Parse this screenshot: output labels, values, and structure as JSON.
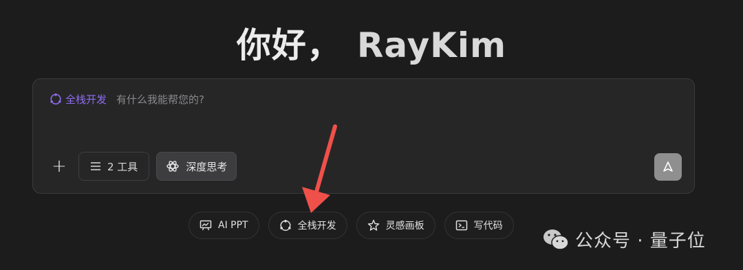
{
  "greeting": {
    "hello": "你好，",
    "name": "RayKim"
  },
  "chatbox": {
    "mode_label": "全栈开发",
    "placeholder": "有什么我能帮您的?",
    "plus_label": "+",
    "tools_label": "2 工具",
    "think_label": "深度思考"
  },
  "chips": [
    {
      "label": "AI PPT",
      "icon": "presentation-icon"
    },
    {
      "label": "全栈开发",
      "icon": "fullstack-icon"
    },
    {
      "label": "灵感画板",
      "icon": "inspiration-icon"
    },
    {
      "label": "写代码",
      "icon": "terminal-icon"
    }
  ],
  "watermark": {
    "text": "公众号 · 量子位"
  },
  "colors": {
    "background": "#1c1c1d",
    "chatbox": "#262627",
    "accent_purple": "#8f6cf0",
    "send_button": "#8f8f90",
    "arrow": "#f0504a"
  }
}
